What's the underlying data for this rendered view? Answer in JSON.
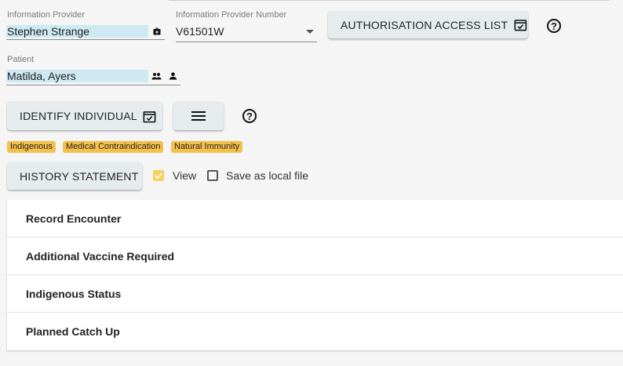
{
  "provider": {
    "label": "Information Provider",
    "value": "Stephen Strange",
    "icon": "medical-bag-icon"
  },
  "provider_number": {
    "label": "Information Provider Number",
    "value": "V61501W"
  },
  "auth_button": {
    "label": "AUTHORISATION ACCESS LIST",
    "icon": "calendar-check-icon"
  },
  "patient": {
    "label": "Patient",
    "value": "Matilda, Ayers",
    "icons": [
      "people-icon",
      "person-icon"
    ]
  },
  "identify_button": {
    "label": "IDENTIFY INDIVIDUAL",
    "icon": "calendar-check-icon"
  },
  "menu_button": {
    "icon": "menu-icon"
  },
  "help_glyph": "?",
  "tags": [
    "Indigenous",
    "Medical Contraindication",
    "Natural Immunity"
  ],
  "history_button": {
    "label": "HISTORY STATEMENT"
  },
  "view_checkbox": {
    "label": "View",
    "checked": true
  },
  "save_checkbox": {
    "label": "Save as local file",
    "checked": false
  },
  "panels": [
    "Record Encounter",
    "Additional Vaccine Required",
    "Indigenous Status",
    "Planned Catch Up"
  ],
  "colors": {
    "tag_bg": "#f5c04a",
    "input_fill": "#cfe9f3",
    "button_bg": "#e6ecee",
    "checkbox_on": "#f7d25a"
  }
}
